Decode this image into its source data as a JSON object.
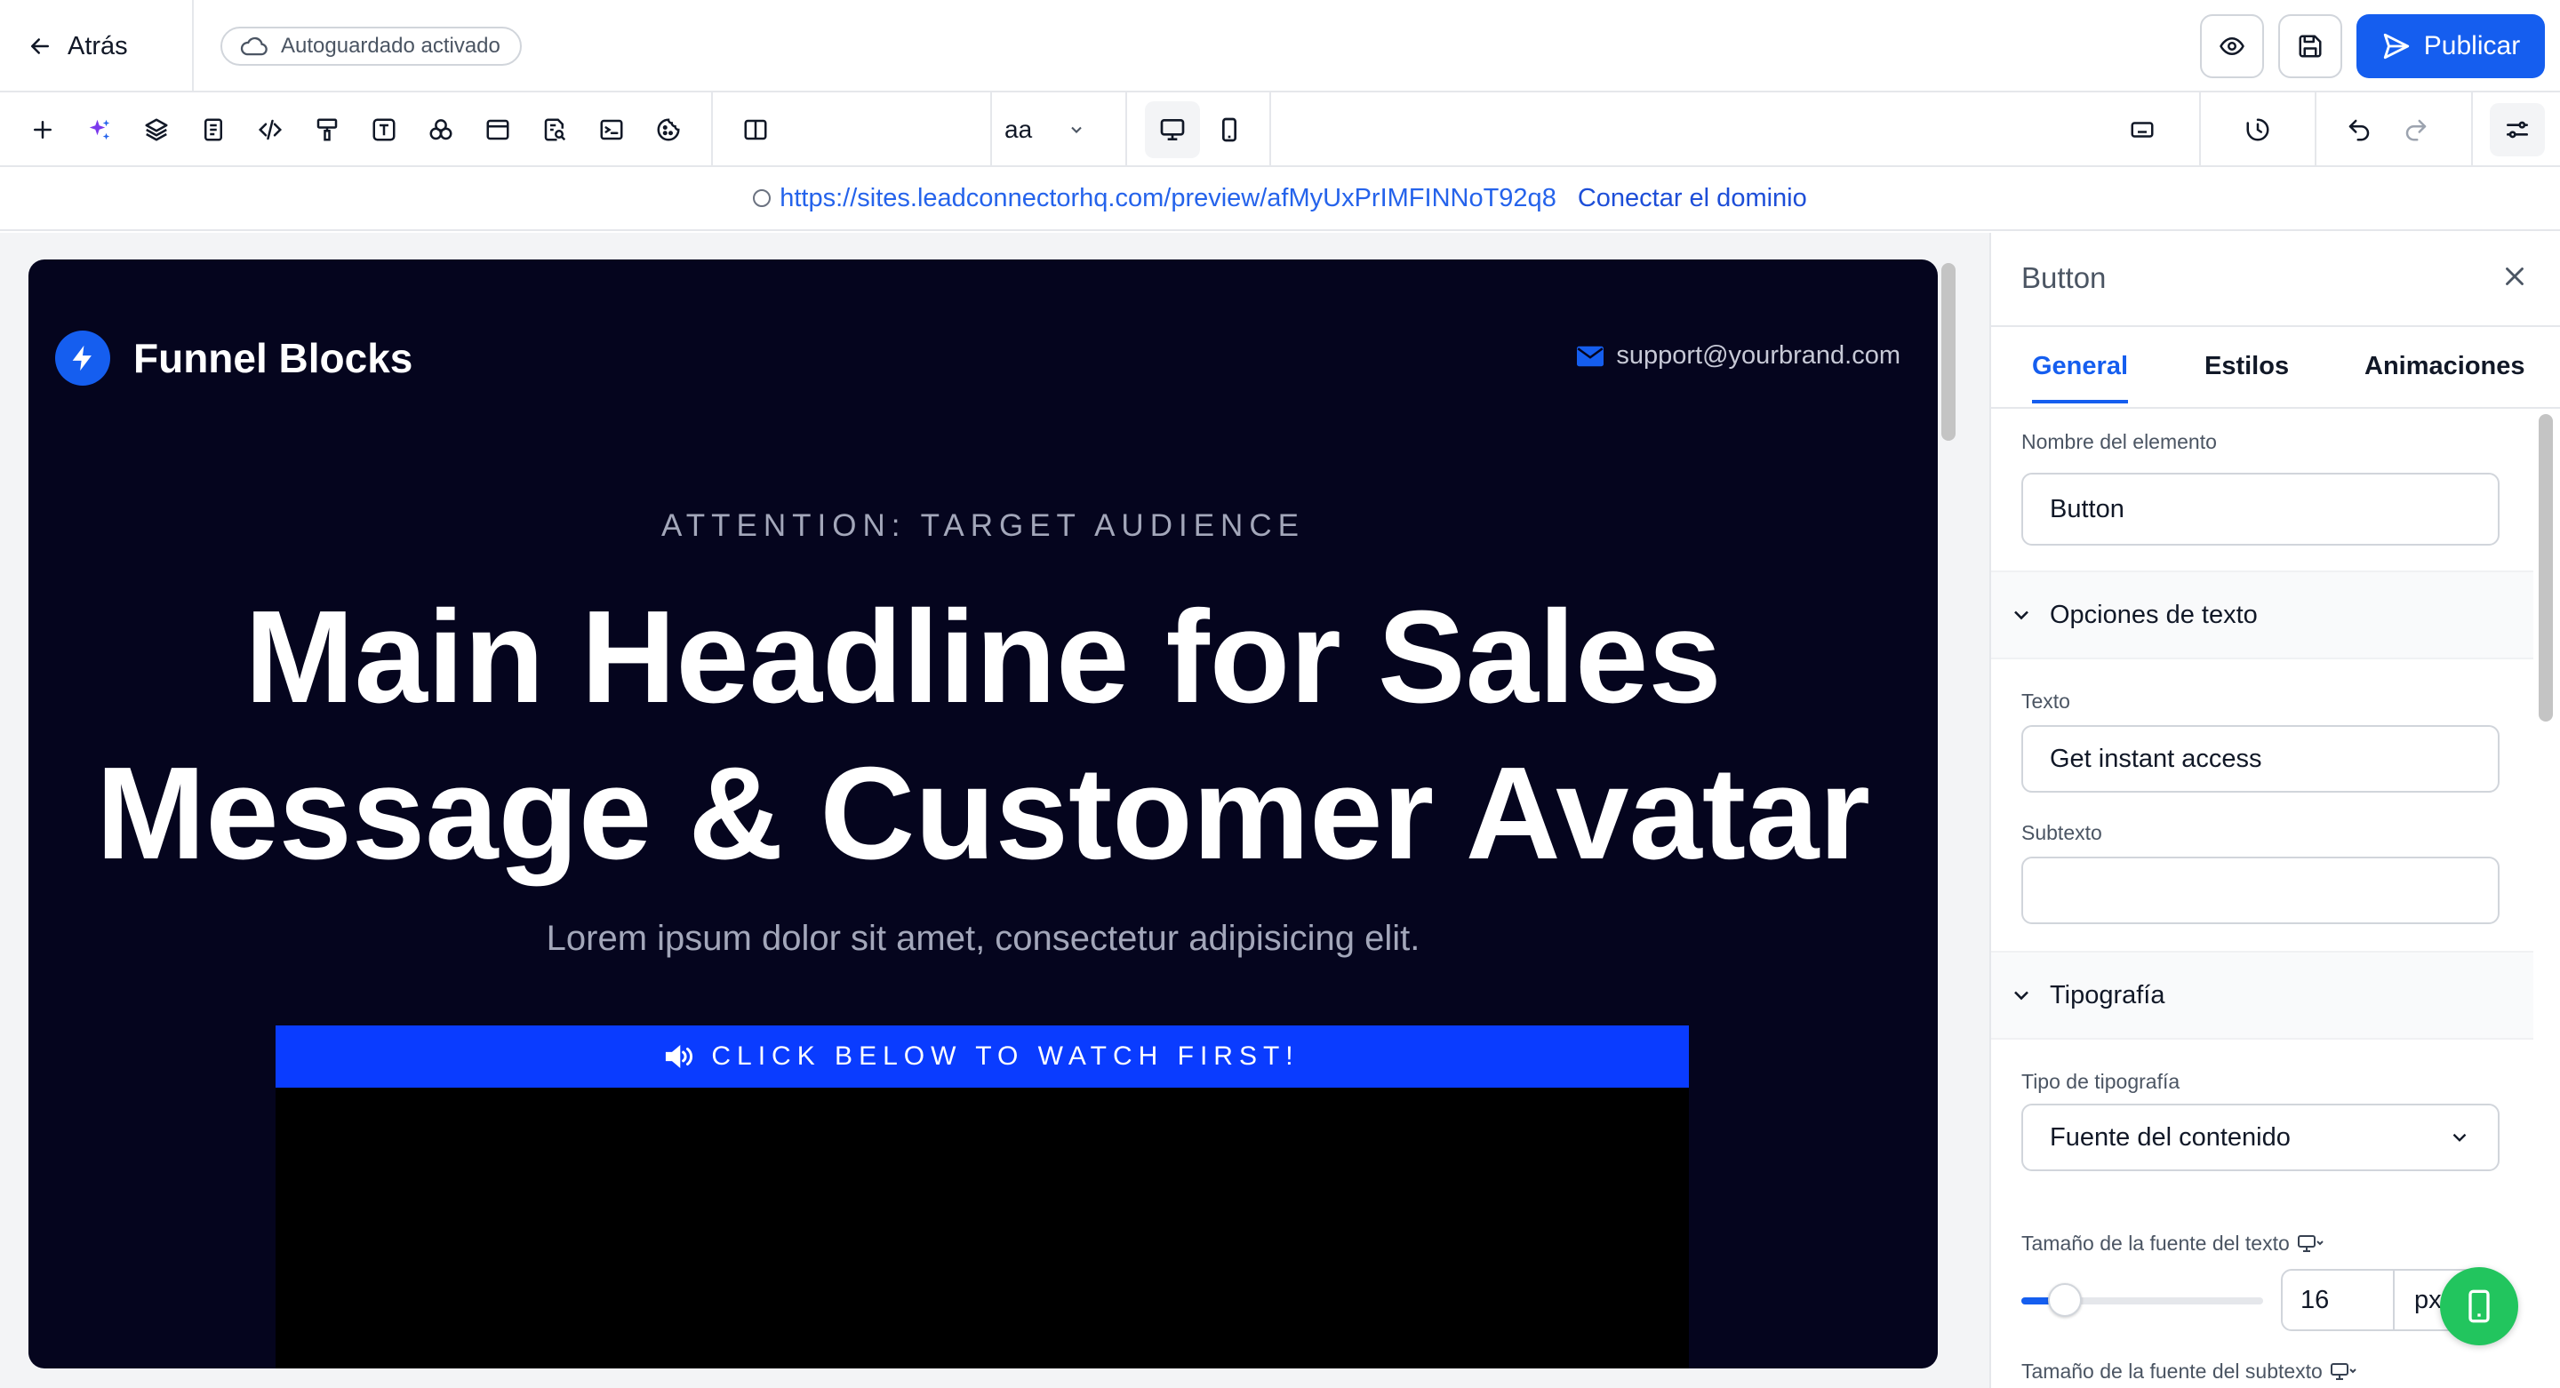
{
  "topbar": {
    "back_label": "Atrás",
    "autosave_label": "Autoguardado activado",
    "publish_label": "Publicar"
  },
  "toolbar": {
    "tools": [
      "add-icon",
      "ai-sparkle-icon",
      "layers-icon",
      "pages-icon",
      "code-icon",
      "paint-roller-icon",
      "text-icon",
      "shapes-icon",
      "browser-window-icon",
      "search-document-icon",
      "terminal-icon",
      "cookie-icon",
      "split-view-icon"
    ],
    "font_selector": "aa",
    "device_active": "desktop"
  },
  "urlbar": {
    "url": "https://sites.leadconnectorhq.com/preview/afMyUxPrIMFINNoT92q8",
    "connect_label": "Conectar el dominio"
  },
  "page": {
    "brand_name": "Funnel Blocks",
    "support_email": "support@yourbrand.com",
    "eyebrow": "ATTENTION: TARGET AUDIENCE",
    "headline_line1": "Main Headline for Sales",
    "headline_line2": "Message & Customer Avatar",
    "subheadline": "Lorem ipsum dolor sit amet, consectetur adipisicing elit.",
    "banner_text": "CLICK BELOW TO WATCH FIRST!"
  },
  "panel": {
    "title": "Button",
    "tabs": [
      "General",
      "Estilos",
      "Animaciones"
    ],
    "active_tab": "General",
    "element_name_label": "Nombre del elemento",
    "element_name_value": "Button",
    "text_options_title": "Opciones de texto",
    "text_label": "Texto",
    "text_value": "Get instant access",
    "subtext_label": "Subtexto",
    "subtext_value": "",
    "typography_title": "Tipografía",
    "font_type_label": "Tipo de tipografía",
    "font_type_value": "Fuente del contenido",
    "font_size_label": "Tamaño de la fuente del texto",
    "font_size_value": "16",
    "font_size_unit": "px",
    "font_size_slider_fraction": 0.11,
    "subtext_size_label": "Tamaño de la fuente del subtexto"
  },
  "colors": {
    "accent": "#155eef",
    "page_bg": "#05051e",
    "banner": "#0a3cff",
    "fab": "#22c55e"
  }
}
